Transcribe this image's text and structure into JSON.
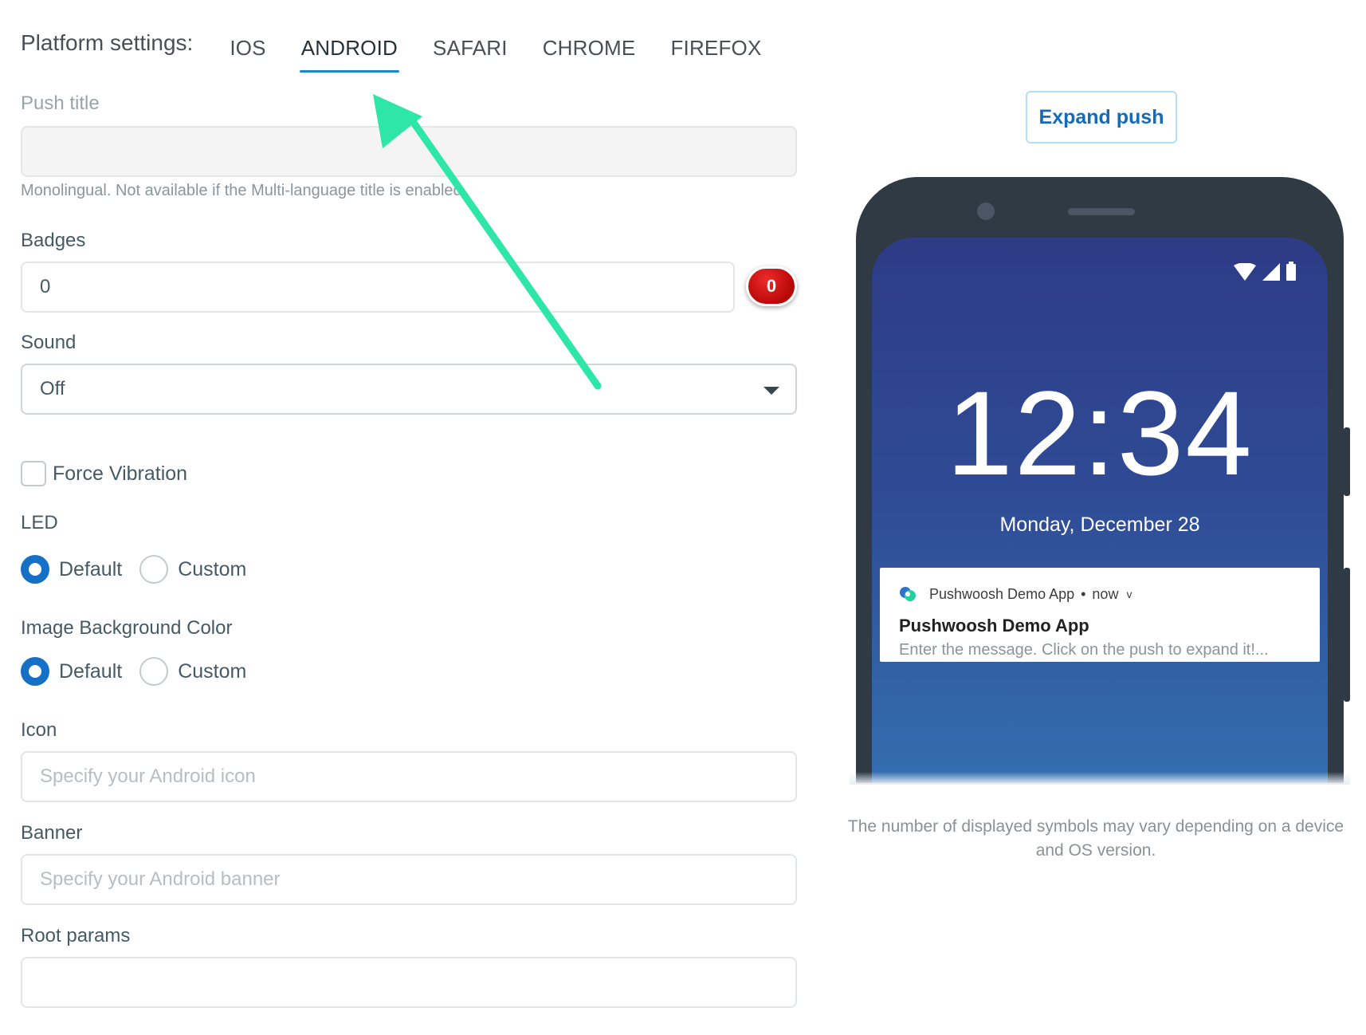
{
  "tabs": {
    "label": "Platform settings:",
    "items": [
      "IOS",
      "ANDROID",
      "SAFARI",
      "CHROME",
      "FIREFOX"
    ],
    "active": "ANDROID"
  },
  "form": {
    "push_title": {
      "label": "Push title",
      "value": "",
      "hint": "Monolingual. Not available if the Multi-language title is enabled."
    },
    "badges": {
      "label": "Badges",
      "value": "0",
      "badge": "0"
    },
    "sound": {
      "label": "Sound",
      "value": "Off"
    },
    "force_vibration": {
      "label": "Force Vibration",
      "checked": false
    },
    "led": {
      "label": "LED",
      "options": [
        "Default",
        "Custom"
      ],
      "selected": "Default"
    },
    "image_bg": {
      "label": "Image Background Color",
      "options": [
        "Default",
        "Custom"
      ],
      "selected": "Default"
    },
    "icon": {
      "label": "Icon",
      "placeholder": "Specify your Android icon"
    },
    "banner": {
      "label": "Banner",
      "placeholder": "Specify your Android banner"
    },
    "root_params": {
      "label": "Root params",
      "value": ""
    }
  },
  "preview": {
    "expand_button": "Expand push",
    "clock": "12:34",
    "date": "Monday, December 28",
    "notification": {
      "app_name": "Pushwoosh Demo App",
      "dot": "•",
      "time": "now",
      "chevron": "v",
      "title": "Pushwoosh Demo App",
      "message": "Enter the message. Click on the push to expand it!..."
    },
    "note": "The number of displayed symbols may vary depending on a device and OS version."
  },
  "colors": {
    "accent": "#1670c6",
    "tab_underline": "#1e88c9",
    "badge_red": "#c40b0b",
    "annotation_arrow": "#2ee6a8"
  }
}
